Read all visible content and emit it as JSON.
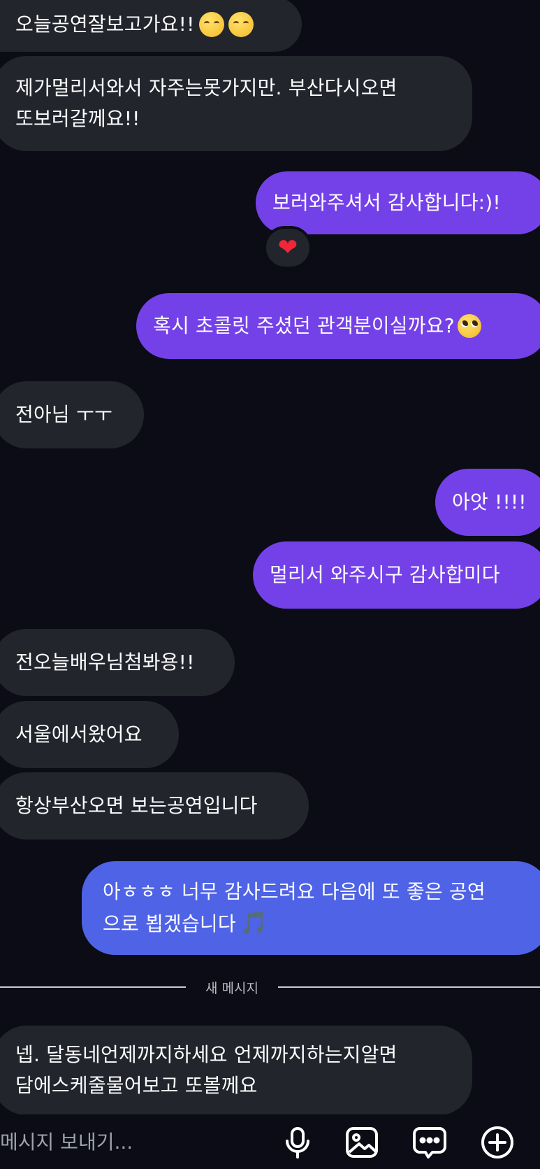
{
  "messages": {
    "m1": {
      "text": "오늘공연잘보고가요!!"
    },
    "m2": {
      "line1": "제가멀리서와서 자주는못가지만. 부산다시오면",
      "line2": "또보러갈께요!!"
    },
    "m3": {
      "text": "보러와주셔서 감사합니다:)!",
      "reaction": "❤"
    },
    "m4": {
      "text": "혹시 초콜릿 주셨던 관객분이실까요?"
    },
    "m5": {
      "text": "전아님 ㅜㅜ"
    },
    "m6": {
      "text": "아앗 !!!!"
    },
    "m7": {
      "text": "멀리서 와주시구 감사합미다"
    },
    "m8": {
      "text": "전오늘배우님첨봐용!!"
    },
    "m9": {
      "text": "서울에서왔어요"
    },
    "m10": {
      "text": "항상부산오면 보는공연입니다"
    },
    "m11": {
      "line1": "아ㅎㅎㅎ 너무 감사드려요 다음에 또 좋은 공연",
      "line2": "으로 뵙겠습니다",
      "note": "🎵"
    },
    "m12": {
      "line1": "넵. 달동네언제까지하세요 언제까지하는지알면",
      "line2": "담에스케줄물어보고 또볼께요"
    }
  },
  "divider": {
    "label": "새 메시지"
  },
  "composer": {
    "placeholder": "메시지 보내기...",
    "icons": [
      "microphone-icon",
      "image-icon",
      "chat-bubble-icon",
      "add-icon"
    ]
  },
  "colors": {
    "background": "#0b0c15",
    "incoming_bubble": "#23252d",
    "outgoing_bubble": "#7441e8",
    "outgoing_bubble_latest": "#4e63e6",
    "reaction_heart": "#f0263a"
  }
}
